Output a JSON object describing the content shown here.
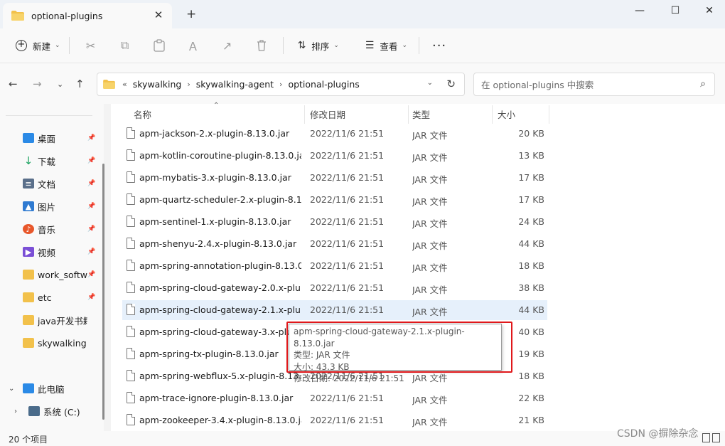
{
  "window": {
    "tab_title": "optional-plugins",
    "new_tab": "+",
    "minimize": "—",
    "maximize": "☐",
    "close": "✕",
    "tab_close": "✕"
  },
  "toolbar": {
    "new_label": "新建",
    "sort_label": "排序",
    "view_label": "查看",
    "more": "···",
    "cut_icon": "✂",
    "copy_icon": "⧉",
    "paste_icon": "📋",
    "rename_icon": "Ａ",
    "share_icon": "↗",
    "delete_icon": "🗑"
  },
  "address": {
    "breadcrumb_prefix": "«",
    "crumbs": [
      "skywalking",
      "skywalking-agent",
      "optional-plugins"
    ],
    "search_placeholder": "在 optional-plugins 中搜索"
  },
  "sidebar": {
    "items": [
      {
        "label": "桌面",
        "icon": "desktop-icon",
        "color": "#2b8ae6",
        "pinned": true
      },
      {
        "label": "下载",
        "icon": "download-icon",
        "color": "#1aa360",
        "pinned": true
      },
      {
        "label": "文档",
        "icon": "document-icon",
        "color": "#5a6f8a",
        "pinned": true
      },
      {
        "label": "图片",
        "icon": "pictures-icon",
        "color": "#2f7ad1",
        "pinned": true
      },
      {
        "label": "音乐",
        "icon": "music-icon",
        "color": "#e8572b",
        "pinned": true
      },
      {
        "label": "视频",
        "icon": "video-icon",
        "color": "#7b4fd6",
        "pinned": true
      },
      {
        "label": "work_software",
        "icon": "folder-icon",
        "color": "#f2c14b",
        "pinned": true
      },
      {
        "label": "etc",
        "icon": "folder-icon",
        "color": "#f2c14b",
        "pinned": true
      },
      {
        "label": "java开发书籍",
        "icon": "folder-icon",
        "color": "#f2c14b",
        "pinned": false
      },
      {
        "label": "skywalking",
        "icon": "folder-icon",
        "color": "#f2c14b",
        "pinned": false
      }
    ],
    "this_pc": "此电脑",
    "drive_c": "系统 (C:)"
  },
  "columns": {
    "name": "名称",
    "date": "修改日期",
    "type": "类型",
    "size": "大小"
  },
  "files": [
    {
      "name": "apm-jackson-2.x-plugin-8.13.0.jar",
      "date": "2022/11/6 21:51",
      "type": "JAR 文件",
      "size": "20 KB"
    },
    {
      "name": "apm-kotlin-coroutine-plugin-8.13.0.jar",
      "date": "2022/11/6 21:51",
      "type": "JAR 文件",
      "size": "13 KB"
    },
    {
      "name": "apm-mybatis-3.x-plugin-8.13.0.jar",
      "date": "2022/11/6 21:51",
      "type": "JAR 文件",
      "size": "17 KB"
    },
    {
      "name": "apm-quartz-scheduler-2.x-plugin-8.1...",
      "date": "2022/11/6 21:51",
      "type": "JAR 文件",
      "size": "17 KB"
    },
    {
      "name": "apm-sentinel-1.x-plugin-8.13.0.jar",
      "date": "2022/11/6 21:51",
      "type": "JAR 文件",
      "size": "24 KB"
    },
    {
      "name": "apm-shenyu-2.4.x-plugin-8.13.0.jar",
      "date": "2022/11/6 21:51",
      "type": "JAR 文件",
      "size": "44 KB"
    },
    {
      "name": "apm-spring-annotation-plugin-8.13.0...",
      "date": "2022/11/6 21:51",
      "type": "JAR 文件",
      "size": "18 KB"
    },
    {
      "name": "apm-spring-cloud-gateway-2.0.x-plu...",
      "date": "2022/11/6 21:51",
      "type": "JAR 文件",
      "size": "38 KB"
    },
    {
      "name": "apm-spring-cloud-gateway-2.1.x-plu...",
      "date": "2022/11/6 21:51",
      "type": "JAR 文件",
      "size": "44 KB",
      "selected": true
    },
    {
      "name": "apm-spring-cloud-gateway-3.x-plug",
      "date": "2022/11/6 21:51",
      "type": "JAR 文件",
      "size": "40 KB"
    },
    {
      "name": "apm-spring-tx-plugin-8.13.0.jar",
      "date": "2022/11/6 21:51",
      "type": "JAR 文件",
      "size": "19 KB"
    },
    {
      "name": "apm-spring-webflux-5.x-plugin-8.13....",
      "date": "2022/11/6 21:51",
      "type": "JAR 文件",
      "size": "18 KB"
    },
    {
      "name": "apm-trace-ignore-plugin-8.13.0.jar",
      "date": "2022/11/6 21:51",
      "type": "JAR 文件",
      "size": "22 KB"
    },
    {
      "name": "apm-zookeeper-3.4.x-plugin-8.13.0.jar",
      "date": "2022/11/6 21:51",
      "type": "JAR 文件",
      "size": "21 KB"
    }
  ],
  "tooltip": {
    "line1": "apm-spring-cloud-gateway-2.1.x-plugin-8.13.0.jar",
    "line2": "类型: JAR 文件",
    "line3": "大小: 43.3 KB",
    "line4": "修改日期: 2022/11/6 21:51"
  },
  "status": {
    "count": "20 个项目",
    "watermark": "CSDN @摒除杂念"
  },
  "colors": {
    "highlight": "#e0181b",
    "selection": "#e6f0fb",
    "folder": "#f2c14b"
  }
}
